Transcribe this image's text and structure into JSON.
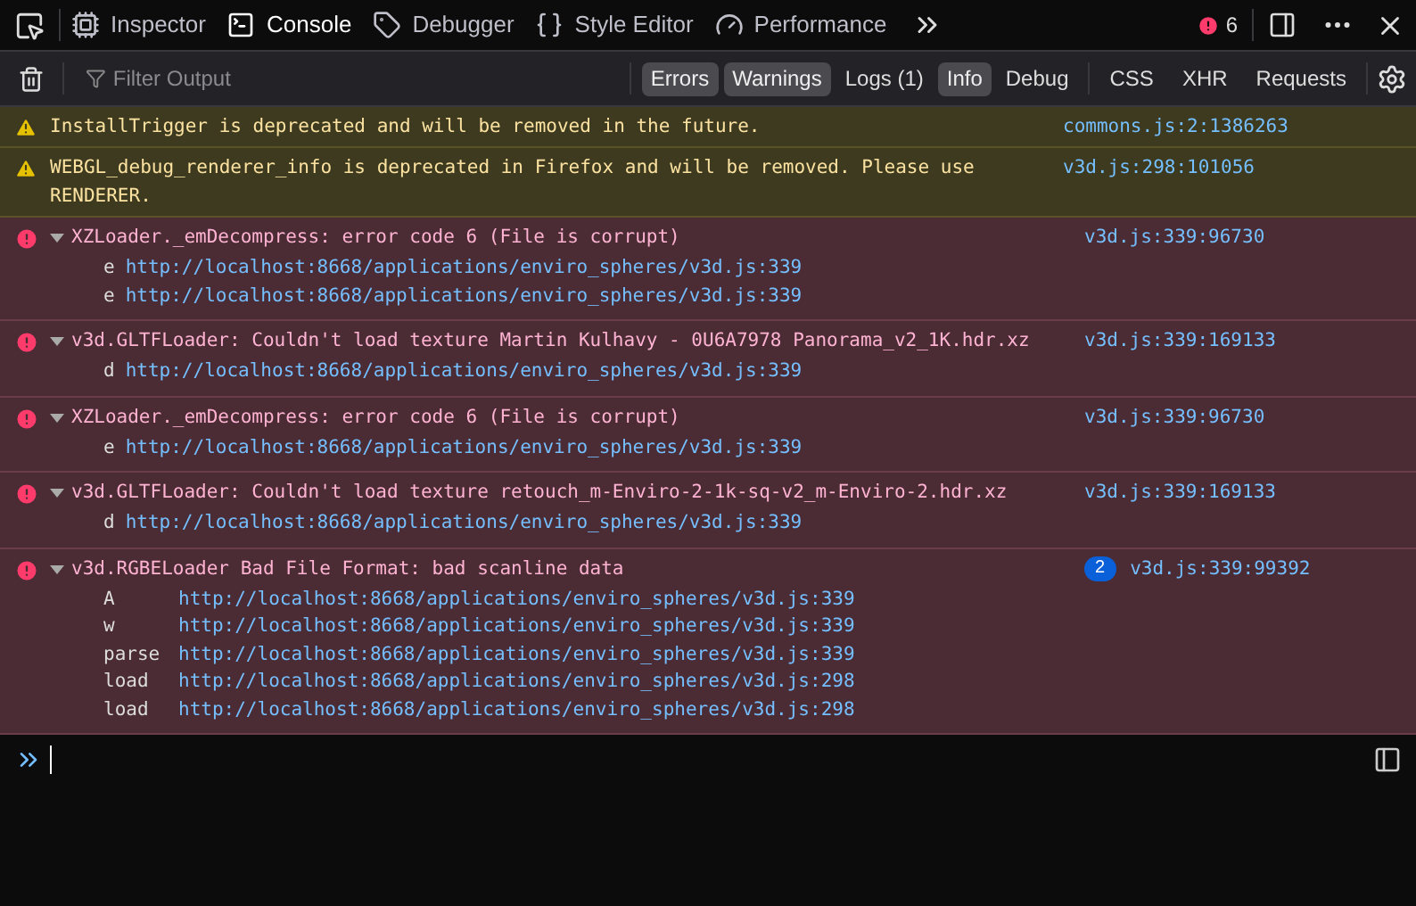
{
  "toolbar": {
    "tabs": [
      {
        "label": "Inspector",
        "kind": "inspector",
        "selected": false
      },
      {
        "label": "Console",
        "kind": "console",
        "selected": true
      },
      {
        "label": "Debugger",
        "kind": "debugger",
        "selected": false
      },
      {
        "label": "Style Editor",
        "kind": "style",
        "selected": false
      },
      {
        "label": "Performance",
        "kind": "performance",
        "selected": false
      }
    ],
    "error_count": "6"
  },
  "filter_bar": {
    "placeholder": "Filter Output",
    "levels": [
      {
        "label": "Errors",
        "selected": true
      },
      {
        "label": "Warnings",
        "selected": true
      },
      {
        "label": "Logs (1)",
        "selected": false
      },
      {
        "label": "Info",
        "selected": true
      },
      {
        "label": "Debug",
        "selected": false
      }
    ],
    "requests": [
      {
        "label": "CSS",
        "selected": false
      },
      {
        "label": "XHR",
        "selected": false
      },
      {
        "label": "Requests",
        "selected": false
      }
    ]
  },
  "messages": [
    {
      "kind": "warning",
      "text": "InstallTrigger is deprecated and will be removed in the future.",
      "source": "commons.js:2:1386263"
    },
    {
      "kind": "warning",
      "text": "WEBGL_debug_renderer_info is deprecated in Firefox and will be removed. Please use RENDERER.",
      "source": "v3d.js:298:101056"
    },
    {
      "kind": "error",
      "expanded": true,
      "text": "XZLoader._emDecompress: error code 6 (File is corrupt)",
      "source": "v3d.js:339:96730",
      "trace": [
        {
          "fn": "e",
          "url": "http://localhost:8668/applications/enviro_spheres/v3d.js:339"
        },
        {
          "fn": "e",
          "url": "http://localhost:8668/applications/enviro_spheres/v3d.js:339"
        }
      ]
    },
    {
      "kind": "error",
      "expanded": true,
      "text": "v3d.GLTFLoader: Couldn't load texture Martin Kulhavy - 0U6A7978 Panorama_v2_1K.hdr.xz",
      "source": "v3d.js:339:169133",
      "trace": [
        {
          "fn": "d",
          "url": "http://localhost:8668/applications/enviro_spheres/v3d.js:339"
        }
      ]
    },
    {
      "kind": "error",
      "expanded": true,
      "text": "XZLoader._emDecompress: error code 6 (File is corrupt)",
      "source": "v3d.js:339:96730",
      "trace": [
        {
          "fn": "e",
          "url": "http://localhost:8668/applications/enviro_spheres/v3d.js:339"
        }
      ]
    },
    {
      "kind": "error",
      "expanded": true,
      "text": "v3d.GLTFLoader: Couldn't load texture retouch_m-Enviro-2-1k-sq-v2_m-Enviro-2.hdr.xz",
      "source": "v3d.js:339:169133",
      "trace": [
        {
          "fn": "d",
          "url": "http://localhost:8668/applications/enviro_spheres/v3d.js:339"
        }
      ]
    },
    {
      "kind": "error",
      "expanded": true,
      "text": "v3d.RGBELoader Bad File Format: bad scanline data",
      "source": "v3d.js:339:99392",
      "repeat": "2",
      "trace": [
        {
          "fn": "A",
          "url": "http://localhost:8668/applications/enviro_spheres/v3d.js:339"
        },
        {
          "fn": "w",
          "url": "http://localhost:8668/applications/enviro_spheres/v3d.js:339"
        },
        {
          "fn": "parse",
          "url": "http://localhost:8668/applications/enviro_spheres/v3d.js:339"
        },
        {
          "fn": "load",
          "url": "http://localhost:8668/applications/enviro_spheres/v3d.js:298"
        },
        {
          "fn": "load",
          "url": "http://localhost:8668/applications/enviro_spheres/v3d.js:298"
        }
      ]
    }
  ]
}
